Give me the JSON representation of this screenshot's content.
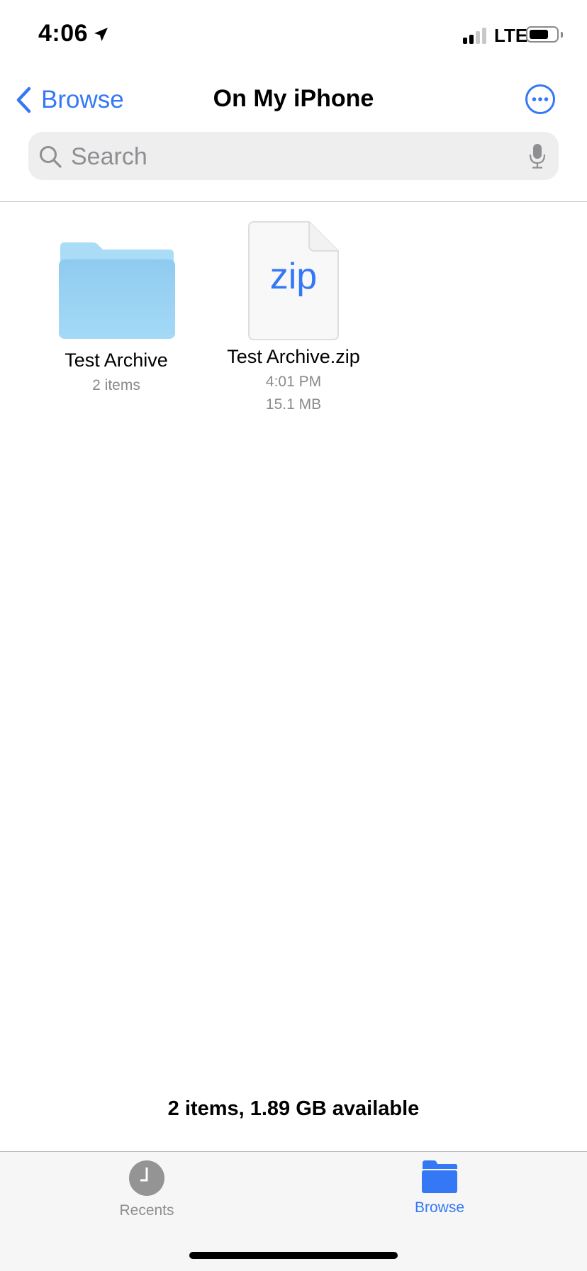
{
  "status_bar": {
    "time": "4:06",
    "network": "LTE",
    "signal_bars_active": 2,
    "signal_bars_total": 4,
    "battery_level": 0.6,
    "icons": [
      "location-arrow-icon",
      "signal-icon",
      "battery-icon"
    ]
  },
  "nav": {
    "back_label": "Browse",
    "title": "On My iPhone",
    "more_icon": "ellipsis-circle-icon"
  },
  "search": {
    "placeholder": "Search",
    "value": ""
  },
  "items": [
    {
      "name": "Test Archive",
      "type": "folder",
      "meta": [
        "2 items"
      ]
    },
    {
      "name": "Test Archive.zip",
      "type": "zip",
      "badge": "zip",
      "meta": [
        "4:01 PM",
        "15.1 MB"
      ]
    }
  ],
  "summary": "2 items, 1.89 GB available",
  "tabs": [
    {
      "label": "Recents",
      "icon": "clock-icon",
      "active": false
    },
    {
      "label": "Browse",
      "icon": "folder-icon",
      "active": true
    }
  ],
  "colors": {
    "accent": "#3478f6",
    "folder_light": "#a9dcf7",
    "folder": "#95cff2",
    "secondary_text": "#8a8a8e",
    "tabbar_bg": "#f6f6f6"
  }
}
